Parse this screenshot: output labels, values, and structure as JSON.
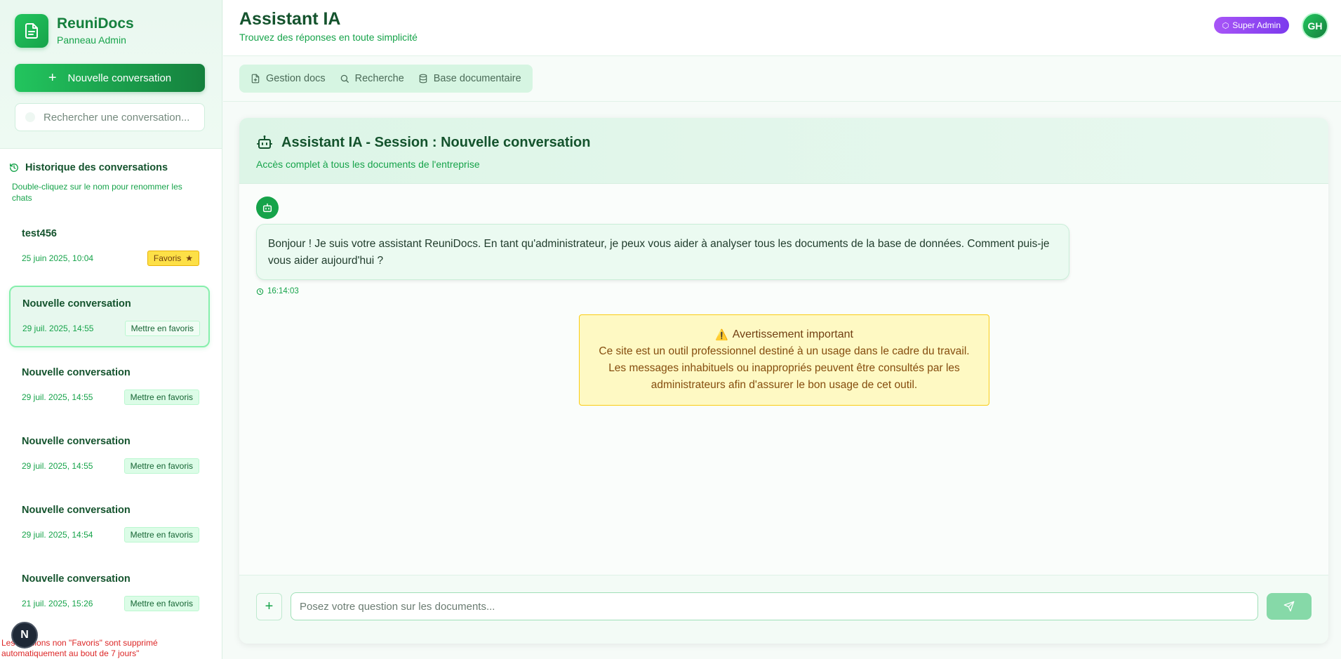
{
  "brand": {
    "title": "ReuniDocs",
    "subtitle": "Panneau Admin"
  },
  "sidebar": {
    "new_conversation_label": "Nouvelle conversation",
    "search_placeholder": "Rechercher une conversation...",
    "history_title": "Historique des conversations",
    "history_hint": "Double-cliquez sur le nom pour renommer les chats",
    "conversations": [
      {
        "title": "test456",
        "date": "25 juin 2025, 10:04",
        "favorite_label": "Favoris",
        "is_favorite": true,
        "active": false
      },
      {
        "title": "Nouvelle conversation",
        "date": "29 juil. 2025, 14:55",
        "favorite_label": "Mettre en favoris",
        "is_favorite": false,
        "active": true
      },
      {
        "title": "Nouvelle conversation",
        "date": "29 juil. 2025, 14:55",
        "favorite_label": "Mettre en favoris",
        "is_favorite": false,
        "active": false
      },
      {
        "title": "Nouvelle conversation",
        "date": "29 juil. 2025, 14:55",
        "favorite_label": "Mettre en favoris",
        "is_favorite": false,
        "active": false
      },
      {
        "title": "Nouvelle conversation",
        "date": "29 juil. 2025, 14:54",
        "favorite_label": "Mettre en favoris",
        "is_favorite": false,
        "active": false
      },
      {
        "title": "Nouvelle conversation",
        "date": "21 juil. 2025, 15:26",
        "favorite_label": "Mettre en favoris",
        "is_favorite": false,
        "active": false
      }
    ],
    "cleanup_notice": "Les sessions non \"Favoris\" sont supprimé automatiquement au bout de 7 jours\"",
    "bottom_avatar": "N"
  },
  "header": {
    "title": "Assistant IA",
    "subtitle": "Trouvez des réponses en toute simplicité",
    "role_badge": "Super Admin",
    "user_initials": "GH"
  },
  "nav": {
    "tabs": [
      {
        "label": "Gestion docs",
        "icon": "file-plus-icon"
      },
      {
        "label": "Recherche",
        "icon": "search-icon"
      },
      {
        "label": "Base documentaire",
        "icon": "database-icon"
      }
    ]
  },
  "chat": {
    "title": "Assistant IA - Session : Nouvelle conversation",
    "subtitle": "Accès complet à tous les documents de l'entreprise",
    "messages": [
      {
        "role": "assistant",
        "text": "Bonjour ! Je suis votre assistant ReuniDocs. En tant qu'administrateur, je peux vous aider à analyser tous les documents de la base de données. Comment puis-je vous aider aujourd'hui ?",
        "time": "16:14:03"
      }
    ],
    "warning": {
      "title": "Avertissement important",
      "body": "Ce site est un outil professionnel destiné à un usage dans le cadre du travail. Les messages inhabituels ou inappropriés peuvent être consultés par les administrateurs afin d'assurer le bon usage de cet outil."
    },
    "input_placeholder": "Posez votre question sur les documents..."
  },
  "colors": {
    "accent": "#16a34a",
    "accent_dark": "#14532d",
    "badge_purple": "#8b5cf6",
    "warning_bg": "#fef9c3",
    "favorite": "#fde047"
  }
}
